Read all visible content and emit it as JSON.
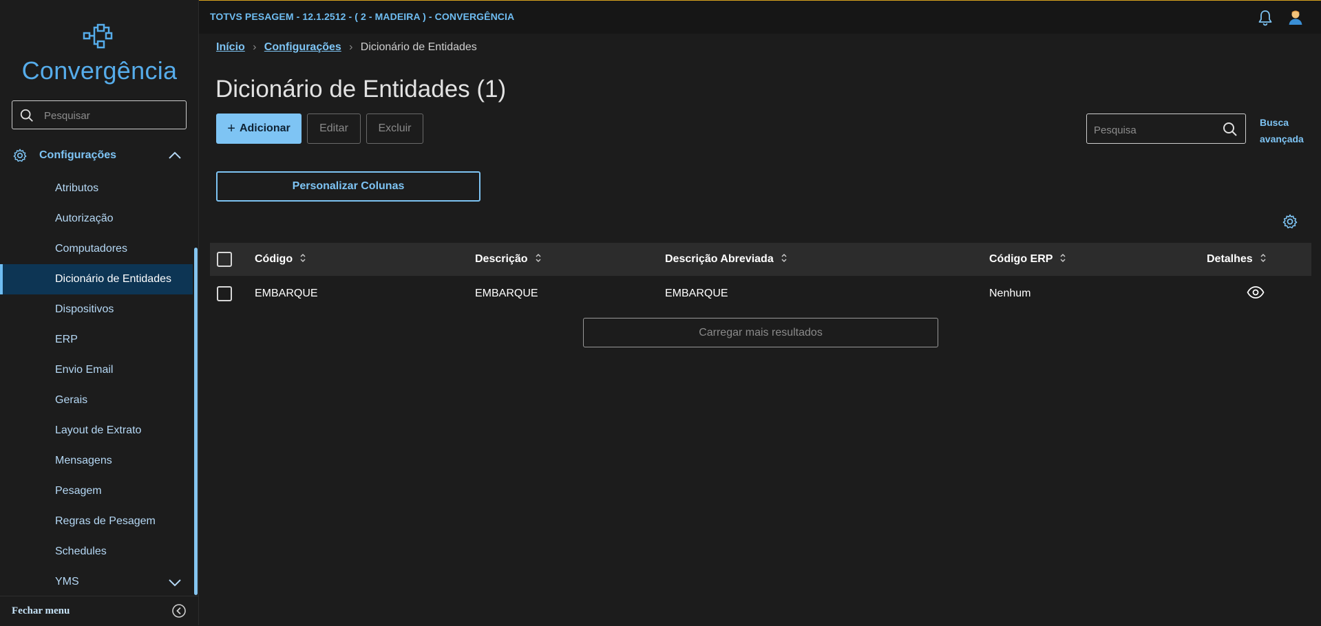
{
  "header": {
    "title": "TOTVS PESAGEM - 12.1.2512 - ( 2 - MADEIRA ) - CONVERGÊNCIA"
  },
  "sidebar": {
    "brand": "Convergência",
    "search_placeholder": "Pesquisar",
    "section_label": "Configurações",
    "items": [
      {
        "label": "Atributos"
      },
      {
        "label": "Autorização"
      },
      {
        "label": "Computadores"
      },
      {
        "label": "Dicionário de Entidades",
        "active": true
      },
      {
        "label": "Dispositivos"
      },
      {
        "label": "ERP"
      },
      {
        "label": "Envio Email"
      },
      {
        "label": "Gerais"
      },
      {
        "label": "Layout de Extrato"
      },
      {
        "label": "Mensagens"
      },
      {
        "label": "Pesagem"
      },
      {
        "label": "Regras de Pesagem"
      },
      {
        "label": "Schedules"
      },
      {
        "label": "YMS"
      }
    ],
    "footer_label": "Fechar menu"
  },
  "breadcrumb": {
    "home": "Início",
    "section": "Configurações",
    "current": "Dicionário de Entidades"
  },
  "page": {
    "title": "Dicionário de Entidades (1)"
  },
  "toolbar": {
    "add_label": "Adicionar",
    "edit_label": "Editar",
    "delete_label": "Excluir",
    "search_placeholder": "Pesquisa",
    "advanced_search_line1": "Busca",
    "advanced_search_line2": "avançada",
    "customize_columns_label": "Personalizar Colunas"
  },
  "table": {
    "columns": [
      "Código",
      "Descrição",
      "Descrição Abreviada",
      "Código ERP",
      "Detalhes"
    ],
    "rows": [
      {
        "codigo": "EMBARQUE",
        "descricao": "EMBARQUE",
        "descricao_abreviada": "EMBARQUE",
        "codigo_erp": "Nenhum"
      }
    ],
    "load_more_label": "Carregar mais resultados"
  },
  "colors": {
    "accent": "#7ec4f4",
    "brand": "#56acea",
    "background": "#1c1c1c",
    "active_item_bg": "#0d3554",
    "top_border": "#d9a31f"
  }
}
